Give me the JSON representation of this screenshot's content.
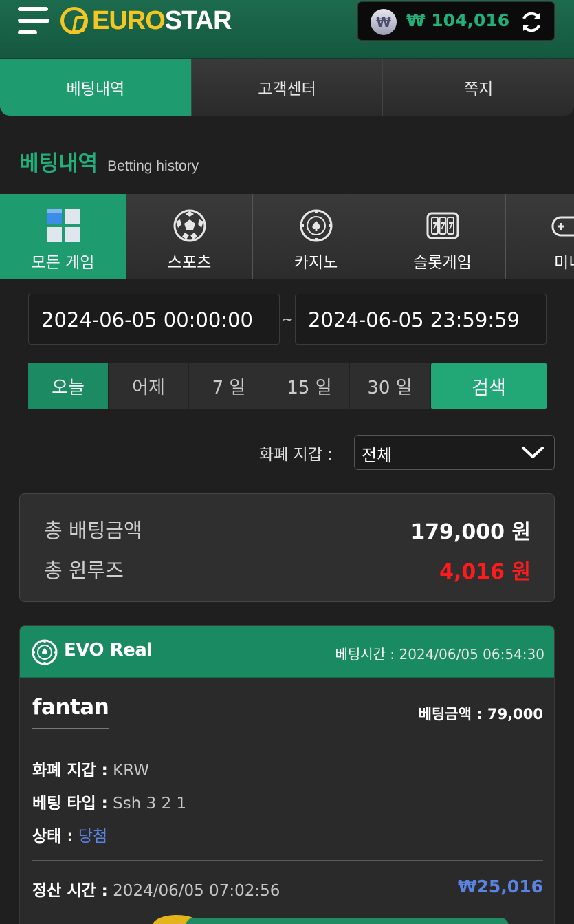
{
  "header": {
    "logo_prefix": "EURO",
    "logo_suffix": "STAR",
    "wallet_symbol": "₩",
    "wallet_amount": "₩ 104,016",
    "accent_color": "#1e9c70"
  },
  "top_tabs": [
    {
      "label": "베팅내역",
      "active": true
    },
    {
      "label": "고객센터",
      "active": false
    },
    {
      "label": "쪽지",
      "active": false
    }
  ],
  "section": {
    "title_ko": "베팅내역",
    "title_en": "Betting history"
  },
  "categories": [
    {
      "label": "모든 게임",
      "icon": "all-games-icon",
      "active": true
    },
    {
      "label": "스포츠",
      "icon": "soccer-ball-icon",
      "active": false
    },
    {
      "label": "카지노",
      "icon": "casino-chip-icon",
      "active": false
    },
    {
      "label": "슬롯게임",
      "icon": "slot-machine-icon",
      "active": false
    },
    {
      "label": "미니",
      "icon": "gamepad-icon",
      "active": false
    }
  ],
  "date_range": {
    "start": "2024-06-05 00:00:00",
    "separator": "~",
    "end": "2024-06-05 23:59:59"
  },
  "periods": [
    {
      "label": "오늘",
      "active": true
    },
    {
      "label": "어제",
      "active": false
    },
    {
      "label": "7 일",
      "active": false
    },
    {
      "label": "15 일",
      "active": false
    },
    {
      "label": "30 일",
      "active": false
    }
  ],
  "search_label": "검색",
  "currency_filter": {
    "label": "화폐 지갑 :",
    "selected": "전체"
  },
  "summary": {
    "total_bet_label": "총 배팅금액",
    "total_bet_value": "179,000 원",
    "total_winloss_label": "총 윈루즈",
    "total_winloss_value": "4,016 원",
    "winloss_color": "#ff1b1b"
  },
  "bet_card": {
    "provider": "EVO Real",
    "bet_time_label": "베팅시간 :",
    "bet_time": "2024/06/05 06:54:30",
    "game": "fantan",
    "bet_amount_label": "베팅금액 :",
    "bet_amount": "79,000",
    "currency_label": "화폐 지갑 :",
    "currency": "KRW",
    "bet_type_label": "베팅 타입 :",
    "bet_type": "Ssh 3 2 1",
    "status_label": "상태 :",
    "status": "당첨",
    "settle_label": "정산 시간 :",
    "settle_time": "2024/06/05 07:02:56",
    "payout": "₩25,016"
  }
}
